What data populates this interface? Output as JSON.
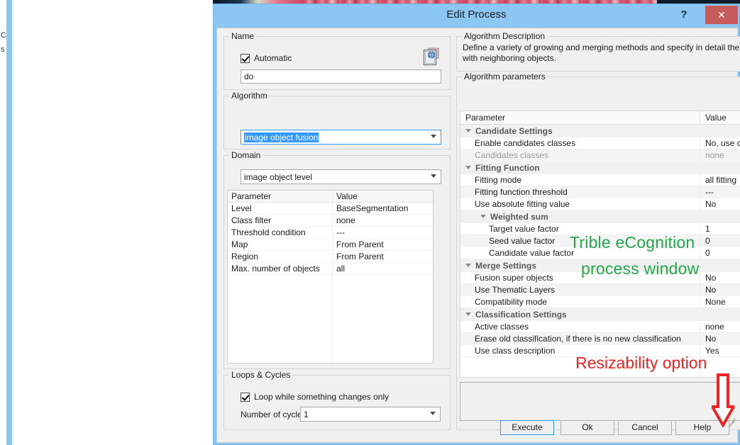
{
  "window": {
    "title": "Edit Process",
    "help_glyph": "?",
    "close_glyph": "✕"
  },
  "background": {
    "sliver_text_1": "C",
    "sliver_text_2": "s"
  },
  "left_panel": {
    "name_group": {
      "legend": "Name",
      "automatic_checkbox_label": "Automatic",
      "automatic_checked": true,
      "name_value": "do",
      "icon": "document-globe-icon"
    },
    "algorithm_group": {
      "legend": "Algorithm",
      "selected": "image object fusion"
    },
    "domain_group": {
      "legend": "Domain",
      "selected": "image object level",
      "table": {
        "headers": [
          "Parameter",
          "Value"
        ],
        "rows": [
          [
            "Level",
            "BaseSegmentation"
          ],
          [
            "Class filter",
            "none"
          ],
          [
            "Threshold condition",
            "---"
          ],
          [
            "Map",
            "From Parent"
          ],
          [
            "Region",
            "From Parent"
          ],
          [
            "Max. number of objects",
            "all"
          ]
        ]
      }
    },
    "loops_group": {
      "legend": "Loops & Cycles",
      "loop_checkbox_label": "Loop while something changes only",
      "loop_checked": true,
      "cycles_label": "Number of cycles",
      "cycles_value": "1"
    }
  },
  "right_panel": {
    "description_group": {
      "legend": "Algorithm Description",
      "text": "Define a variety of growing and merging methods and specify in detail the conditions for merger of the current image object with neighboring objects."
    },
    "parameters_group": {
      "legend": "Algorithm parameters",
      "headers": [
        "Parameter",
        "Value"
      ],
      "rows": [
        {
          "kind": "group",
          "level": 1,
          "label": "Candidate Settings",
          "value": ""
        },
        {
          "kind": "item",
          "level": 1,
          "label": "Enable candidates classes",
          "value": "No, use classes from image object domain"
        },
        {
          "kind": "item",
          "level": 1,
          "label": "Candidates classes",
          "value": "none",
          "dim": true
        },
        {
          "kind": "group",
          "level": 1,
          "label": "Fitting Function",
          "value": ""
        },
        {
          "kind": "item",
          "level": 1,
          "label": "Fitting mode",
          "value": "all fitting"
        },
        {
          "kind": "item",
          "level": 1,
          "label": "Fitting function threshold",
          "value": "---"
        },
        {
          "kind": "item",
          "level": 1,
          "label": "Use absolute fitting value",
          "value": "No"
        },
        {
          "kind": "group",
          "level": 2,
          "label": "Weighted sum",
          "value": ""
        },
        {
          "kind": "item",
          "level": 2,
          "label": "Target value factor",
          "value": "1"
        },
        {
          "kind": "item",
          "level": 2,
          "label": "Seed value factor",
          "value": "0"
        },
        {
          "kind": "item",
          "level": 2,
          "label": "Candidate value factor",
          "value": "0"
        },
        {
          "kind": "group",
          "level": 1,
          "label": "Merge Settings",
          "value": ""
        },
        {
          "kind": "item",
          "level": 1,
          "label": "Fusion super objects",
          "value": "No"
        },
        {
          "kind": "item",
          "level": 1,
          "label": "Use Thematic Layers",
          "value": "No"
        },
        {
          "kind": "item",
          "level": 1,
          "label": "Compatibility mode",
          "value": "None"
        },
        {
          "kind": "group",
          "level": 1,
          "label": "Classification Settings",
          "value": ""
        },
        {
          "kind": "item",
          "level": 1,
          "label": "Active classes",
          "value": "none"
        },
        {
          "kind": "item",
          "level": 1,
          "label": "Erase old classification, if there is no new classification",
          "value": "No"
        },
        {
          "kind": "item",
          "level": 1,
          "label": "Use class description",
          "value": "Yes"
        }
      ]
    }
  },
  "footer": {
    "execute": "Execute",
    "ok": "Ok",
    "cancel": "Cancel",
    "help": "Help"
  },
  "annotations": {
    "green_line_1": "Trible eCognition",
    "green_line_2": "process window",
    "green_color": "#22a84a",
    "red_text": "Resizability option",
    "red_color": "#f02323"
  }
}
